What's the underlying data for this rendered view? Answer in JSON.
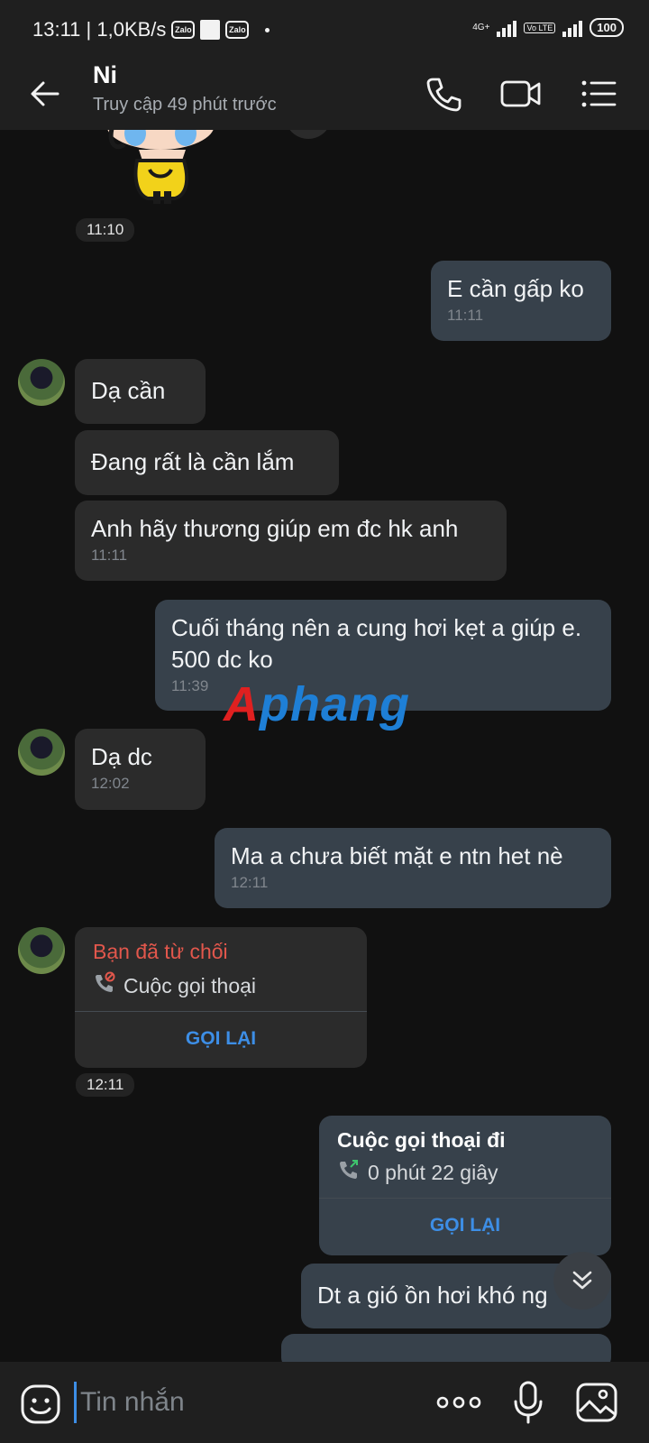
{
  "status_bar": {
    "time_speed": "13:11 | 1,0KB/s",
    "app_badge_1": "Zalo",
    "app_badge_2": "Zalo",
    "network_1": "4G+",
    "network_2": "Vo LTE",
    "battery": "100"
  },
  "header": {
    "contact_name": "Ni",
    "contact_status": "Truy cập 49 phút trước",
    "icons": [
      "back-arrow-icon",
      "phone-icon",
      "video-call-icon",
      "menu-list-icon"
    ]
  },
  "chat": {
    "sticker_time": "11:10",
    "messages": [
      {
        "dir": "out",
        "text": "E cần gấp ko",
        "time": "11:11"
      },
      {
        "dir": "in",
        "text": "Dạ cần",
        "time": ""
      },
      {
        "dir": "in",
        "text": "Đang rất là cần lắm",
        "time": ""
      },
      {
        "dir": "in",
        "text": "Anh hãy thương giúp em đc hk anh",
        "time": "11:11"
      },
      {
        "dir": "out",
        "text": "Cuối tháng nên a cung hơi kẹt a giúp e. 500 dc ko",
        "time": "11:39"
      },
      {
        "dir": "in",
        "text": "Dạ dc",
        "time": "12:02"
      },
      {
        "dir": "out",
        "text": "Ma a chưa biết mặt e ntn het nè",
        "time": "12:11"
      },
      {
        "dir": "out",
        "text": "Dt a gió ồn hơi khó ng",
        "time": ""
      }
    ],
    "missed_call": {
      "title": "Bạn đã từ chối",
      "subtitle": "Cuộc gọi thoại",
      "action": "GỌI LẠI",
      "time": "12:11"
    },
    "outgoing_call": {
      "title": "Cuộc gọi thoại đi",
      "duration": "0 phút 22 giây",
      "action": "GỌI LẠI"
    },
    "watermark": {
      "first": "A",
      "rest": "phang"
    }
  },
  "input_bar": {
    "placeholder": "Tin nhắn"
  },
  "colors": {
    "accent": "#3d8ee6",
    "declined": "#e2574c",
    "bubble_in": "#2b2b2b",
    "bubble_out": "#37414b"
  }
}
